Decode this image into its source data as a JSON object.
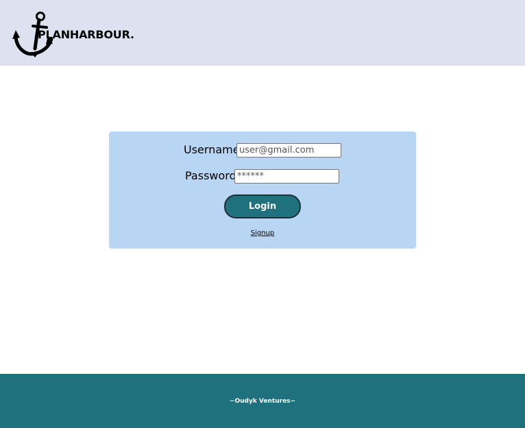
{
  "header": {
    "brand": "PLANHARBOUR.",
    "logo_icon": "anchor-icon",
    "background": "#dde1f0"
  },
  "login": {
    "username_label": "Username:",
    "username_value": "user@gmail.com",
    "password_label": "Password:",
    "password_value": "******",
    "login_button": "Login",
    "signup_link": "Signup",
    "card_color": "#b8d6f3",
    "button_color": "#1f717d"
  },
  "footer": {
    "text": "~Oudyk Ventures~",
    "background": "#1f717d"
  }
}
